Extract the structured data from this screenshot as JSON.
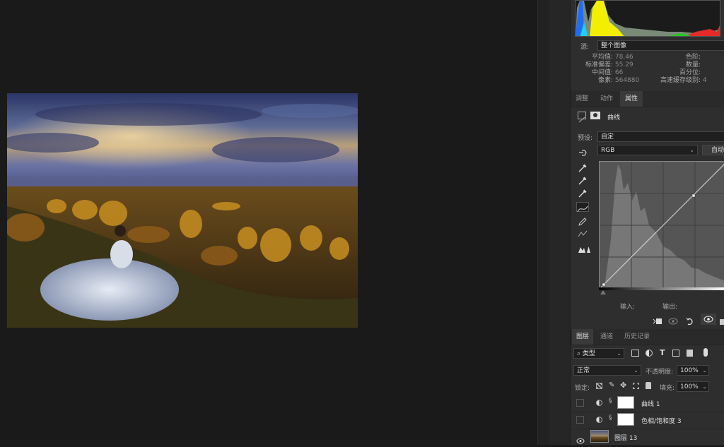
{
  "histogram": {
    "source_label": "源:",
    "source_value": "整个图像",
    "stats": {
      "mean_label": "平均值:",
      "mean": "78.46",
      "stddev_label": "标准偏差:",
      "stddev": "55.29",
      "median_label": "中间值:",
      "median": "66",
      "pixels_label": "像素:",
      "pixels": "564880",
      "level_label": "色阶:",
      "level": "",
      "count_label": "数量:",
      "count": "",
      "percentile_label": "百分位:",
      "percentile": "",
      "cache_label": "高速缓存级别:",
      "cache": "4"
    }
  },
  "props_tabs": [
    "调整",
    "动作",
    "属性"
  ],
  "props_active_tab": "属性",
  "properties": {
    "adjustment_name": "曲线",
    "preset_label": "预设:",
    "preset_value": "自定",
    "channel_value": "RGB",
    "auto_button": "自动",
    "input_label": "输入:",
    "output_label": "输出:"
  },
  "layers_tabs": [
    "图层",
    "通道",
    "历史记录"
  ],
  "layers_active_tab": "图层",
  "layers_panel": {
    "filter_kind": "类型",
    "blend_mode": "正常",
    "opacity_label": "不透明度:",
    "opacity_value": "100%",
    "lock_label": "锁定:",
    "fill_label": "填充:",
    "fill_value": "100%",
    "layers": [
      {
        "name": "曲线 1"
      },
      {
        "name": "色相/饱和度 3"
      },
      {
        "name": "图层 13"
      }
    ]
  },
  "colors": {
    "canvas_bg": "#1a1a1a",
    "panel_bg": "#2e2e2e",
    "accent": "#3a3a3a"
  }
}
